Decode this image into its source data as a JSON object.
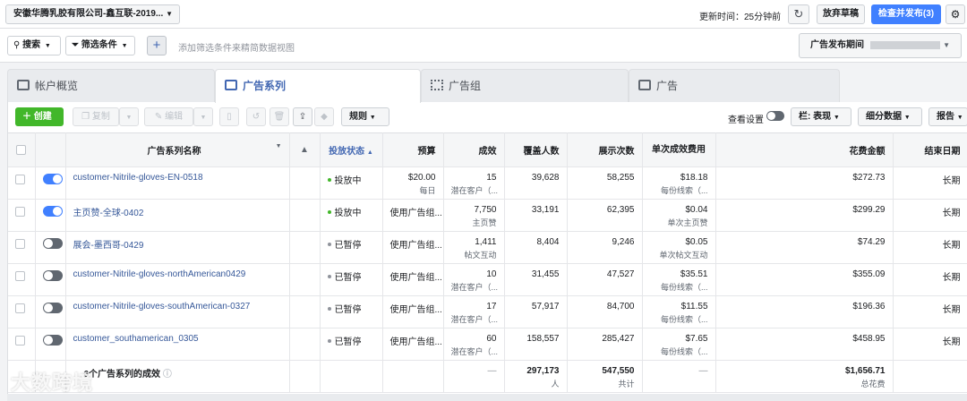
{
  "topbar": {
    "account": "安徽华腾乳胶有限公司-鑫互联-2019...",
    "update_time": "更新时间：25分钟前",
    "discard_draft": "放弃草稿",
    "review_publish": "检查并发布(3)"
  },
  "filterbar": {
    "search": "搜索",
    "filters": "筛选条件",
    "placeholder": "添加筛选条件来精简数据视图",
    "date_label": "广告发布期间"
  },
  "tabs": [
    "帐户概览",
    "广告系列",
    "广告组",
    "广告"
  ],
  "toolbar": {
    "create": "创建",
    "duplicate": "复制",
    "edit": "编辑",
    "rules": "规则",
    "view_settings": "查看设置",
    "columns": "栏: 表现",
    "breakdown": "细分数据",
    "reports": "报告"
  },
  "columns": [
    "广告系列名称",
    "投放状态",
    "预算",
    "成效",
    "覆盖人数",
    "展示次数",
    "单次成效费用",
    "花费金额",
    "结束日期"
  ],
  "rows": [
    {
      "on": true,
      "name": "customer-Nitrile-gloves-EN-0518",
      "status": "投放中",
      "status_color": "#42b72a",
      "budget": "$20.00",
      "budget_sub": "每日",
      "results": "15",
      "results_sub": "潜在客户（...",
      "reach": "39,628",
      "impressions": "58,255",
      "cpr": "$18.18",
      "cpr_sub": "每份线索（...",
      "spend": "$272.73",
      "end": "长期"
    },
    {
      "on": true,
      "name": "主页赞-全球-0402",
      "status": "投放中",
      "status_color": "#42b72a",
      "budget": "使用广告组...",
      "budget_sub": "",
      "results": "7,750",
      "results_sub": "主页赞",
      "reach": "33,191",
      "impressions": "62,395",
      "cpr": "$0.04",
      "cpr_sub": "单次主页赞",
      "spend": "$299.29",
      "end": "长期"
    },
    {
      "on": false,
      "name": "展会-墨西哥-0429",
      "status": "已暂停",
      "status_color": "#90949c",
      "budget": "使用广告组...",
      "budget_sub": "",
      "results": "1,411",
      "results_sub": "帖文互动",
      "reach": "8,404",
      "impressions": "9,246",
      "cpr": "$0.05",
      "cpr_sub": "单次帖文互动",
      "spend": "$74.29",
      "end": "长期"
    },
    {
      "on": false,
      "name": "customer-Nitrile-gloves-northAmerican0429",
      "status": "已暂停",
      "status_color": "#90949c",
      "budget": "使用广告组...",
      "budget_sub": "",
      "results": "10",
      "results_sub": "潜在客户（...",
      "reach": "31,455",
      "impressions": "47,527",
      "cpr": "$35.51",
      "cpr_sub": "每份线索（...",
      "spend": "$355.09",
      "end": "长期"
    },
    {
      "on": false,
      "name": "customer-Nitrile-gloves-southAmerican-0327",
      "status": "已暂停",
      "status_color": "#90949c",
      "budget": "使用广告组...",
      "budget_sub": "",
      "results": "17",
      "results_sub": "潜在客户（...",
      "reach": "57,917",
      "impressions": "84,700",
      "cpr": "$11.55",
      "cpr_sub": "每份线索（...",
      "spend": "$196.36",
      "end": "长期"
    },
    {
      "on": false,
      "name": "customer_southamerican_0305",
      "status": "已暂停",
      "status_color": "#90949c",
      "budget": "使用广告组...",
      "budget_sub": "",
      "results": "60",
      "results_sub": "潜在客户（...",
      "reach": "158,557",
      "impressions": "285,427",
      "cpr": "$7.65",
      "cpr_sub": "每份线索（...",
      "spend": "$458.95",
      "end": "长期"
    }
  ],
  "totals": {
    "label": "6个广告系列的成效",
    "results": "—",
    "reach": "297,173",
    "reach_sub": "人",
    "impressions": "547,550",
    "impressions_sub": "共计",
    "cpr": "—",
    "spend": "$1,656.71",
    "spend_sub": "总花费"
  },
  "watermark": "大数跨境"
}
